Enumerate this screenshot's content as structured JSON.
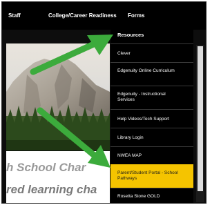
{
  "nav": {
    "items": [
      "Staff",
      "College/Career Readiness",
      "Forms"
    ]
  },
  "dropdown": {
    "header": "Resources",
    "items": [
      "Clever",
      "Edgenuity Online Curriculum",
      "Edgenuity - Instructional Services",
      "Help Videos/Tech Support",
      "Library Login",
      "NWEA MAP",
      "Parent/Student Portal - School Pathways",
      "Rosetta Stone GOLD"
    ],
    "active_index": 6
  },
  "hero": {
    "line1": "h School Char",
    "line2": "red learning cha"
  },
  "colors": {
    "highlight": "#f5c400",
    "arrow": "#3cab3c",
    "background": "#000000"
  }
}
